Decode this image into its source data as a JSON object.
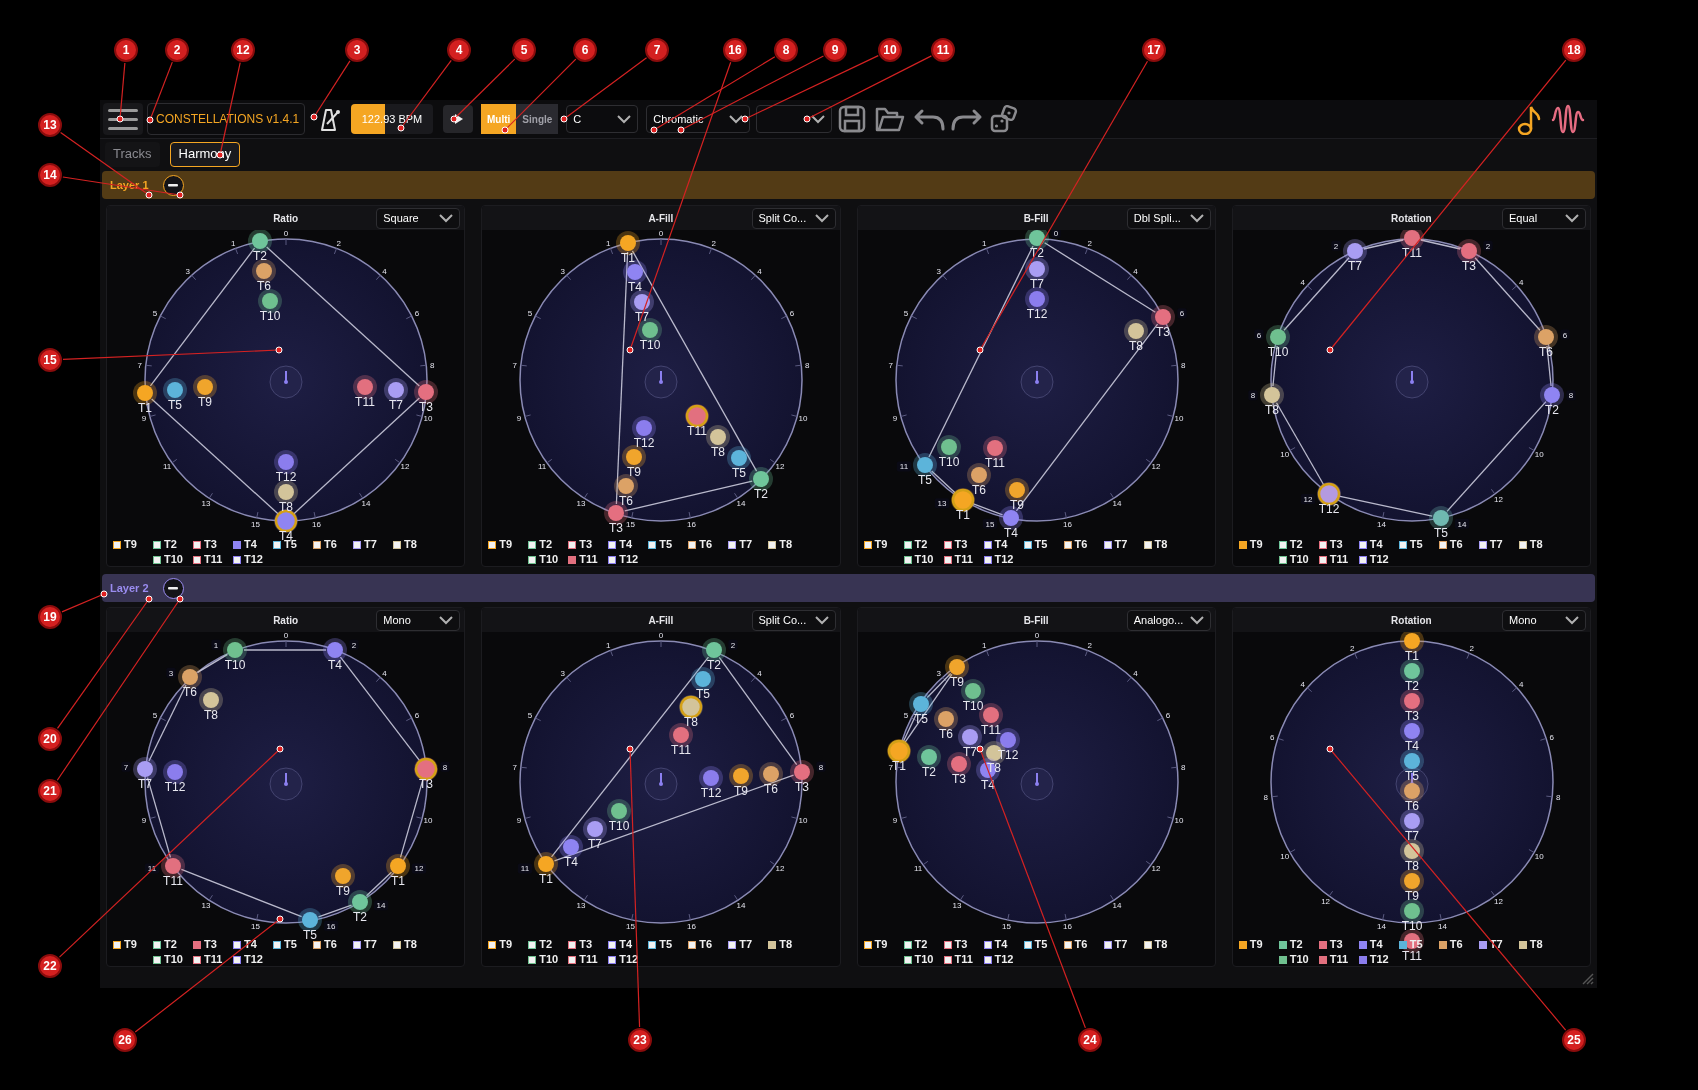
{
  "toolbar": {
    "title": "CONSTELLATIONS v1.4.1",
    "tempo": {
      "text": "122.93 BPM",
      "level": 0.42
    },
    "mode_toggle": [
      {
        "label": "Multi",
        "selected": true
      },
      {
        "label": "Single",
        "selected": false
      }
    ],
    "key_dropdown": "C",
    "scale_dropdown": "Chromatic"
  },
  "tabs": [
    {
      "label": "Tracks",
      "selected": false
    },
    {
      "label": "Harmony",
      "selected": true
    }
  ],
  "layers": [
    {
      "name": "Layer 1",
      "color": "#f5a623",
      "panels": [
        {
          "title": "Ratio",
          "kind": "ratio",
          "dropdown": "Square",
          "ring_labels": [
            "0",
            "1",
            "2",
            "3",
            "4",
            "5",
            "6",
            "7",
            "8",
            "9",
            "10",
            "11",
            "12",
            "13",
            "14",
            "15",
            "16"
          ],
          "nodes": [
            {
              "label": "T2",
              "color": "#6fc59b",
              "highlighted": false
            },
            {
              "label": "T6",
              "color": "#dca266",
              "highlighted": false
            },
            {
              "label": "T10",
              "color": "#6fc08f",
              "highlighted": false
            },
            {
              "label": "T1",
              "color": "#f5a623",
              "highlighted": false
            },
            {
              "label": "T5",
              "color": "#5cb4da",
              "highlighted": false
            },
            {
              "label": "T9",
              "color": "#f0a52c",
              "highlighted": false
            },
            {
              "label": "T11",
              "color": "#e2707f",
              "highlighted": false
            },
            {
              "label": "T7",
              "color": "#a99df3",
              "highlighted": false
            },
            {
              "label": "T3",
              "color": "#e46f80",
              "highlighted": false
            },
            {
              "label": "T12",
              "color": "#8b7ded",
              "highlighted": false
            },
            {
              "label": "T8",
              "color": "#d3c49a",
              "highlighted": false
            },
            {
              "label": "T4",
              "color": "#8f84f2",
              "highlighted": true
            }
          ],
          "legend": [
            {
              "label": "T9",
              "color": "#f5a623",
              "checked": false
            },
            {
              "label": "T2",
              "color": "#6fc59b",
              "checked": false
            },
            {
              "label": "T3",
              "color": "#e46f80",
              "checked": false
            },
            {
              "label": "T4",
              "color": "#8f84f2",
              "checked": true
            },
            {
              "label": "T5",
              "color": "#5cb4da",
              "checked": false
            },
            {
              "label": "T6",
              "color": "#dca266",
              "checked": false
            },
            {
              "label": "T7",
              "color": "#a99df3",
              "checked": false
            },
            {
              "label": "T8",
              "color": "#d3c49a",
              "checked": false
            },
            {
              "label": "T10",
              "color": "#6fc08f",
              "checked": false
            },
            {
              "label": "T11",
              "color": "#e2707f",
              "checked": false
            },
            {
              "label": "T12",
              "color": "#8b7ded",
              "checked": false
            }
          ]
        },
        {
          "title": "A-Fill",
          "kind": "fill",
          "dropdown": "Split Co...",
          "ring_labels": [
            "0",
            "1",
            "2",
            "3",
            "4",
            "5",
            "6",
            "7",
            "8",
            "9",
            "10",
            "11",
            "12",
            "13",
            "14",
            "15",
            "16"
          ],
          "nodes": [
            {
              "label": "T1",
              "color": "#f5a623",
              "highlighted": false
            },
            {
              "label": "T4",
              "color": "#8f84f2",
              "highlighted": false
            },
            {
              "label": "T7",
              "color": "#a99df3",
              "highlighted": false
            },
            {
              "label": "T10",
              "color": "#6fc08f",
              "highlighted": false
            },
            {
              "label": "T11",
              "color": "#e2707f",
              "highlighted": true
            },
            {
              "label": "T8",
              "color": "#d3c49a",
              "highlighted": false
            },
            {
              "label": "T5",
              "color": "#5cb4da",
              "highlighted": false
            },
            {
              "label": "T2",
              "color": "#6fc59b",
              "highlighted": false
            },
            {
              "label": "T12",
              "color": "#8b7ded",
              "highlighted": false
            },
            {
              "label": "T9",
              "color": "#f0a52c",
              "highlighted": false
            },
            {
              "label": "T6",
              "color": "#dca266",
              "highlighted": false
            },
            {
              "label": "T3",
              "color": "#e46f80",
              "highlighted": false
            }
          ],
          "legend": [
            {
              "label": "T9",
              "color": "#f5a623",
              "checked": false
            },
            {
              "label": "T2",
              "color": "#6fc59b",
              "checked": false
            },
            {
              "label": "T3",
              "color": "#e46f80",
              "checked": false
            },
            {
              "label": "T4",
              "color": "#8f84f2",
              "checked": false
            },
            {
              "label": "T5",
              "color": "#5cb4da",
              "checked": false
            },
            {
              "label": "T6",
              "color": "#dca266",
              "checked": false
            },
            {
              "label": "T7",
              "color": "#a99df3",
              "checked": false
            },
            {
              "label": "T8",
              "color": "#d3c49a",
              "checked": false
            },
            {
              "label": "T10",
              "color": "#6fc08f",
              "checked": false
            },
            {
              "label": "T11",
              "color": "#e2707f",
              "checked": true
            },
            {
              "label": "T12",
              "color": "#8b7ded",
              "checked": false
            }
          ]
        },
        {
          "title": "B-Fill",
          "kind": "fill",
          "dropdown": "Dbl Spli...",
          "ring_labels": [
            "0",
            "1",
            "2",
            "3",
            "4",
            "5",
            "6",
            "7",
            "8",
            "9",
            "10",
            "11",
            "12",
            "13",
            "14",
            "15",
            "16"
          ],
          "nodes": [
            {
              "label": "T2",
              "color": "#6fc59b",
              "highlighted": false
            },
            {
              "label": "T7",
              "color": "#a99df3",
              "highlighted": false
            },
            {
              "label": "T12",
              "color": "#8b7ded",
              "highlighted": false
            },
            {
              "label": "T3",
              "color": "#e46f80",
              "highlighted": false
            },
            {
              "label": "T8",
              "color": "#d3c49a",
              "highlighted": false
            },
            {
              "label": "T5",
              "color": "#5cb4da",
              "highlighted": false
            },
            {
              "label": "T10",
              "color": "#6fc08f",
              "highlighted": false
            },
            {
              "label": "T11",
              "color": "#e2707f",
              "highlighted": false
            },
            {
              "label": "T6",
              "color": "#dca266",
              "highlighted": false
            },
            {
              "label": "T1",
              "color": "#f5a623",
              "highlighted": true
            },
            {
              "label": "T9",
              "color": "#f0a52c",
              "highlighted": false
            },
            {
              "label": "T4",
              "color": "#8f84f2",
              "highlighted": false
            }
          ],
          "legend": [
            {
              "label": "T9",
              "color": "#f5a623",
              "checked": false
            },
            {
              "label": "T2",
              "color": "#6fc59b",
              "checked": false
            },
            {
              "label": "T3",
              "color": "#e46f80",
              "checked": false
            },
            {
              "label": "T4",
              "color": "#8f84f2",
              "checked": false
            },
            {
              "label": "T5",
              "color": "#5cb4da",
              "checked": false
            },
            {
              "label": "T6",
              "color": "#dca266",
              "checked": false
            },
            {
              "label": "T7",
              "color": "#a99df3",
              "checked": false
            },
            {
              "label": "T8",
              "color": "#d3c49a",
              "checked": false
            },
            {
              "label": "T10",
              "color": "#6fc08f",
              "checked": false
            },
            {
              "label": "T11",
              "color": "#e2707f",
              "checked": false
            },
            {
              "label": "T12",
              "color": "#8b7ded",
              "checked": false
            }
          ]
        },
        {
          "title": "Rotation",
          "kind": "rotation",
          "dropdown": "Equal",
          "ring_labels": [
            "2",
            "2",
            "4",
            "4",
            "6",
            "6",
            "8",
            "8",
            "10",
            "10",
            "12",
            "12",
            "14",
            "14"
          ],
          "nodes": [
            {
              "label": "T11",
              "color": "#e2707f",
              "highlighted": false
            },
            {
              "label": "T7",
              "color": "#a99df3",
              "highlighted": false
            },
            {
              "label": "T3",
              "color": "#e46f80",
              "highlighted": false
            },
            {
              "label": "T10",
              "color": "#6fc08f",
              "highlighted": false
            },
            {
              "label": "T6",
              "color": "#dca266",
              "highlighted": false
            },
            {
              "label": "T8",
              "color": "#d3c49a",
              "highlighted": false
            },
            {
              "label": "T2",
              "color": "#8f84f2",
              "highlighted": false
            },
            {
              "label": "T12",
              "color": "#b49ae0",
              "highlighted": true
            },
            {
              "label": "T5",
              "color": "#6fb8b0",
              "highlighted": false
            }
          ],
          "legend": [
            {
              "label": "T9",
              "color": "#f5a623",
              "checked": true
            },
            {
              "label": "T2",
              "color": "#6fc59b",
              "checked": false
            },
            {
              "label": "T3",
              "color": "#e46f80",
              "checked": false
            },
            {
              "label": "T4",
              "color": "#8f84f2",
              "checked": false
            },
            {
              "label": "T5",
              "color": "#5cb4da",
              "checked": false
            },
            {
              "label": "T6",
              "color": "#dca266",
              "checked": false
            },
            {
              "label": "T7",
              "color": "#a99df3",
              "checked": false
            },
            {
              "label": "T8",
              "color": "#d3c49a",
              "checked": false
            },
            {
              "label": "T10",
              "color": "#6fc08f",
              "checked": false
            },
            {
              "label": "T11",
              "color": "#e2707f",
              "checked": false
            },
            {
              "label": "T12",
              "color": "#8b7ded",
              "checked": false
            }
          ]
        }
      ]
    },
    {
      "name": "Layer 2",
      "color": "#9a8cf0",
      "panels": [
        {
          "title": "Ratio",
          "kind": "ratio",
          "dropdown": "Mono",
          "ring_labels": [
            "0",
            "1",
            "2",
            "3",
            "4",
            "5",
            "6",
            "7",
            "8",
            "9",
            "10",
            "11",
            "12",
            "13",
            "14",
            "15",
            "16"
          ],
          "nodes": [
            {
              "label": "T10",
              "color": "#6fc08f",
              "highlighted": false
            },
            {
              "label": "T4",
              "color": "#8f84f2",
              "highlighted": false
            },
            {
              "label": "T6",
              "color": "#dca266",
              "highlighted": false
            },
            {
              "label": "T8",
              "color": "#d3c49a",
              "highlighted": false
            },
            {
              "label": "T7",
              "color": "#a99df3",
              "highlighted": false
            },
            {
              "label": "T12",
              "color": "#8b7ded",
              "highlighted": false
            },
            {
              "label": "T3",
              "color": "#e46f80",
              "highlighted": true
            },
            {
              "label": "T11",
              "color": "#e2707f",
              "highlighted": false
            },
            {
              "label": "T9",
              "color": "#f0a52c",
              "highlighted": false
            },
            {
              "label": "T1",
              "color": "#f5a623",
              "highlighted": false
            },
            {
              "label": "T2",
              "color": "#6fc59b",
              "highlighted": false
            },
            {
              "label": "T5",
              "color": "#5cb4da",
              "highlighted": false
            }
          ],
          "legend": [
            {
              "label": "T9",
              "color": "#f5a623",
              "checked": false
            },
            {
              "label": "T2",
              "color": "#6fc59b",
              "checked": false
            },
            {
              "label": "T3",
              "color": "#e46f80",
              "checked": true
            },
            {
              "label": "T4",
              "color": "#8f84f2",
              "checked": false
            },
            {
              "label": "T5",
              "color": "#5cb4da",
              "checked": false
            },
            {
              "label": "T6",
              "color": "#dca266",
              "checked": false
            },
            {
              "label": "T7",
              "color": "#a99df3",
              "checked": false
            },
            {
              "label": "T8",
              "color": "#d3c49a",
              "checked": false
            },
            {
              "label": "T10",
              "color": "#6fc08f",
              "checked": false
            },
            {
              "label": "T11",
              "color": "#e2707f",
              "checked": false
            },
            {
              "label": "T12",
              "color": "#8b7ded",
              "checked": false
            }
          ]
        },
        {
          "title": "A-Fill",
          "kind": "fill",
          "dropdown": "Split Co...",
          "ring_labels": [
            "0",
            "1",
            "2",
            "3",
            "4",
            "5",
            "6",
            "7",
            "8",
            "9",
            "10",
            "11",
            "12",
            "13",
            "14",
            "15",
            "16"
          ],
          "nodes": [
            {
              "label": "T2",
              "color": "#6fc59b",
              "highlighted": false
            },
            {
              "label": "T5",
              "color": "#5cb4da",
              "highlighted": false
            },
            {
              "label": "T8",
              "color": "#d3c49a",
              "highlighted": true
            },
            {
              "label": "T11",
              "color": "#e2707f",
              "highlighted": false
            },
            {
              "label": "T12",
              "color": "#8b7ded",
              "highlighted": false
            },
            {
              "label": "T9",
              "color": "#f0a52c",
              "highlighted": false
            },
            {
              "label": "T6",
              "color": "#dca266",
              "highlighted": false
            },
            {
              "label": "T3",
              "color": "#e46f80",
              "highlighted": false
            },
            {
              "label": "T10",
              "color": "#6fc08f",
              "highlighted": false
            },
            {
              "label": "T7",
              "color": "#a99df3",
              "highlighted": false
            },
            {
              "label": "T4",
              "color": "#8f84f2",
              "highlighted": false
            },
            {
              "label": "T1",
              "color": "#f5a623",
              "highlighted": false
            }
          ],
          "legend": [
            {
              "label": "T9",
              "color": "#f5a623",
              "checked": false
            },
            {
              "label": "T2",
              "color": "#6fc59b",
              "checked": false
            },
            {
              "label": "T3",
              "color": "#e46f80",
              "checked": false
            },
            {
              "label": "T4",
              "color": "#8f84f2",
              "checked": false
            },
            {
              "label": "T5",
              "color": "#5cb4da",
              "checked": false
            },
            {
              "label": "T6",
              "color": "#dca266",
              "checked": false
            },
            {
              "label": "T7",
              "color": "#a99df3",
              "checked": false
            },
            {
              "label": "T8",
              "color": "#d3c49a",
              "checked": true
            },
            {
              "label": "T10",
              "color": "#6fc08f",
              "checked": false
            },
            {
              "label": "T11",
              "color": "#e2707f",
              "checked": false
            },
            {
              "label": "T12",
              "color": "#8b7ded",
              "checked": false
            }
          ]
        },
        {
          "title": "B-Fill",
          "kind": "fill",
          "dropdown": "Analogo...",
          "ring_labels": [
            "0",
            "1",
            "2",
            "3",
            "4",
            "5",
            "6",
            "7",
            "8",
            "9",
            "10",
            "11",
            "12",
            "13",
            "14",
            "15",
            "16"
          ],
          "nodes": [
            {
              "label": "T9",
              "color": "#f0a52c",
              "highlighted": false
            },
            {
              "label": "T10",
              "color": "#6fc08f",
              "highlighted": false
            },
            {
              "label": "T5",
              "color": "#5cb4da",
              "highlighted": false
            },
            {
              "label": "T11",
              "color": "#e2707f",
              "highlighted": false
            },
            {
              "label": "T6",
              "color": "#dca266",
              "highlighted": false
            },
            {
              "label": "T7",
              "color": "#a99df3",
              "highlighted": false
            },
            {
              "label": "T12",
              "color": "#8b7ded",
              "highlighted": false
            },
            {
              "label": "T1",
              "color": "#f5a623",
              "highlighted": true
            },
            {
              "label": "T8",
              "color": "#d3c49a",
              "highlighted": false
            },
            {
              "label": "T2",
              "color": "#6fc59b",
              "highlighted": false
            },
            {
              "label": "T3",
              "color": "#e46f80",
              "highlighted": false
            },
            {
              "label": "T4",
              "color": "#8f84f2",
              "highlighted": false
            }
          ],
          "legend": [
            {
              "label": "T9",
              "color": "#f5a623",
              "checked": false
            },
            {
              "label": "T2",
              "color": "#6fc59b",
              "checked": false
            },
            {
              "label": "T3",
              "color": "#e46f80",
              "checked": false
            },
            {
              "label": "T4",
              "color": "#8f84f2",
              "checked": false
            },
            {
              "label": "T5",
              "color": "#5cb4da",
              "checked": false
            },
            {
              "label": "T6",
              "color": "#dca266",
              "checked": false
            },
            {
              "label": "T7",
              "color": "#a99df3",
              "checked": false
            },
            {
              "label": "T8",
              "color": "#d3c49a",
              "checked": false
            },
            {
              "label": "T10",
              "color": "#6fc08f",
              "checked": false
            },
            {
              "label": "T11",
              "color": "#e2707f",
              "checked": false
            },
            {
              "label": "T12",
              "color": "#8b7ded",
              "checked": false
            }
          ]
        },
        {
          "title": "Rotation",
          "kind": "rotation",
          "dropdown": "Mono",
          "ring_labels": [
            "2",
            "2",
            "4",
            "4",
            "6",
            "6",
            "8",
            "8",
            "10",
            "10",
            "12",
            "12",
            "14",
            "14"
          ],
          "nodes": [
            {
              "label": "T1",
              "color": "#f5a623",
              "highlighted": false
            },
            {
              "label": "T2",
              "color": "#6fc59b",
              "highlighted": false
            },
            {
              "label": "T3",
              "color": "#e46f80",
              "highlighted": false
            },
            {
              "label": "T4",
              "color": "#8f84f2",
              "highlighted": false
            },
            {
              "label": "T5",
              "color": "#5cb4da",
              "highlighted": false
            },
            {
              "label": "T6",
              "color": "#dca266",
              "highlighted": false
            },
            {
              "label": "T7",
              "color": "#a99df3",
              "highlighted": false
            },
            {
              "label": "T8",
              "color": "#d3c49a",
              "highlighted": false
            },
            {
              "label": "T9",
              "color": "#f0a52c",
              "highlighted": false
            },
            {
              "label": "T10",
              "color": "#6fc08f",
              "highlighted": false
            },
            {
              "label": "T11",
              "color": "#e2707f",
              "highlighted": false
            }
          ],
          "legend": [
            {
              "label": "T9",
              "color": "#f5a623",
              "checked": true
            },
            {
              "label": "T2",
              "color": "#6fc59b",
              "checked": true
            },
            {
              "label": "T3",
              "color": "#e46f80",
              "checked": true
            },
            {
              "label": "T4",
              "color": "#8f84f2",
              "checked": true
            },
            {
              "label": "T5",
              "color": "#5cb4da",
              "checked": true
            },
            {
              "label": "T6",
              "color": "#dca266",
              "checked": true
            },
            {
              "label": "T7",
              "color": "#a99df3",
              "checked": true
            },
            {
              "label": "T8",
              "color": "#d3c49a",
              "checked": true
            },
            {
              "label": "T10",
              "color": "#6fc08f",
              "checked": true
            },
            {
              "label": "T11",
              "color": "#e2707f",
              "checked": true
            },
            {
              "label": "T12",
              "color": "#8b7ded",
              "checked": true
            }
          ]
        }
      ]
    }
  ],
  "callouts": [
    "1",
    "2",
    "12",
    "3",
    "4",
    "5",
    "6",
    "7",
    "16",
    "8",
    "9",
    "10",
    "11",
    "17",
    "18",
    "13",
    "14",
    "15",
    "19",
    "20",
    "21",
    "22",
    "26",
    "23",
    "24",
    "25"
  ]
}
